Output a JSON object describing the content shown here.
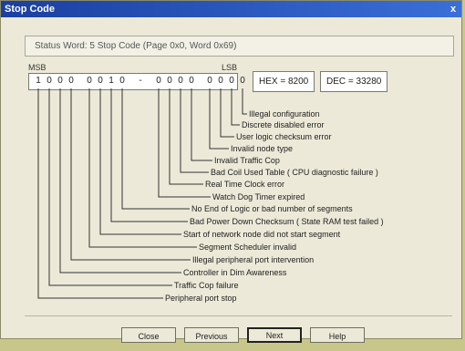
{
  "window": {
    "title": "Stop Code",
    "close_glyph": "x"
  },
  "status": {
    "text": "Status Word: 5  Stop Code (Page 0x0, Word 0x69)"
  },
  "bits": {
    "msb_label": "MSB",
    "lsb_label": "LSB",
    "digits": [
      "1",
      "0",
      "0",
      "0",
      "0",
      "0",
      "1",
      "0",
      "-",
      "0",
      "0",
      "0",
      "0",
      "0",
      "0",
      "0",
      "0"
    ]
  },
  "hex": {
    "text": "HEX = 8200"
  },
  "dec": {
    "text": "DEC = 33280"
  },
  "descriptions": [
    "Illegal configuration",
    "Discrete disabled error",
    "User logic checksum error",
    "Invalid node type",
    "Invalid Traffic Cop",
    "Bad Coil Used Table  ( CPU diagnostic failure )",
    "Real Time Clock error",
    "Watch Dog Timer expired",
    "No End of Logic or bad number of segments",
    "Bad Power Down Checksum    ( State RAM test failed )",
    "Start of network node did not start segment",
    "Segment Scheduler invalid",
    "Illegal peripheral port intervention",
    "Controller in Dim Awareness",
    "Traffic Cop failure",
    "Peripheral port stop"
  ],
  "buttons": {
    "close": "Close",
    "previous": "Previous",
    "next": "Next",
    "help": "Help"
  }
}
